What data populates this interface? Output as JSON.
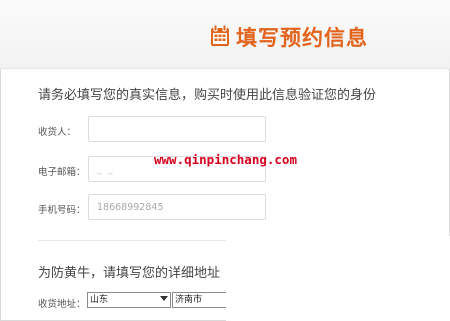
{
  "header": {
    "title": "填写预约信息",
    "icon": "calendar-icon",
    "accent_color": "#e2631b"
  },
  "section1": {
    "lead": "请务必填写您的真实信息，购买时使用此信息验证您的身份",
    "fields": [
      {
        "label": "收货人：",
        "value": "",
        "placeholder": ""
      },
      {
        "label": "电子邮箱：",
        "value": "_  _",
        "placeholder": ""
      },
      {
        "label": "手机号码：",
        "value": "",
        "placeholder": "18668992845"
      }
    ]
  },
  "watermark": "www.qinpinchang.com",
  "section2": {
    "lead": "为防黄牛，请填写您的详细地址",
    "address_label": "收货地址：",
    "province": "山东",
    "city": "济南市"
  }
}
